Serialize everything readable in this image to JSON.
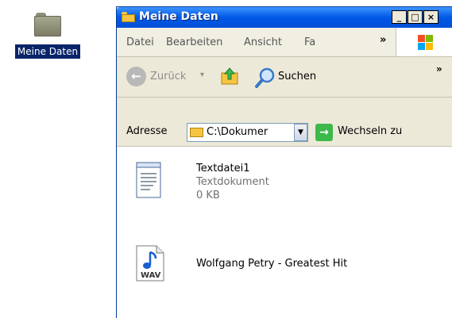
{
  "desktop": {
    "icon_label": "Meine Daten"
  },
  "window": {
    "title": "Meine Daten",
    "buttons": {
      "minimize": "_",
      "maximize": "□",
      "close": "×"
    }
  },
  "menubar": {
    "items": [
      "Datei",
      "Bearbeiten",
      "Ansicht",
      "Fa"
    ],
    "overflow": "»"
  },
  "toolbar": {
    "back_label": "Zurück",
    "back_dropdown": "▾",
    "search_label": "Suchen",
    "overflow": "»"
  },
  "addressbar": {
    "label": "Adresse",
    "value": "C:\\Dokumer",
    "go_label": "Wechseln zu"
  },
  "files": [
    {
      "name": "Textdatei1",
      "type": "Textdokument",
      "size": "0 KB",
      "icon": "text-document-icon"
    },
    {
      "name": "Wolfgang Petry - Greatest Hit",
      "icon": "wav-audio-icon",
      "badge": "WAV"
    }
  ]
}
